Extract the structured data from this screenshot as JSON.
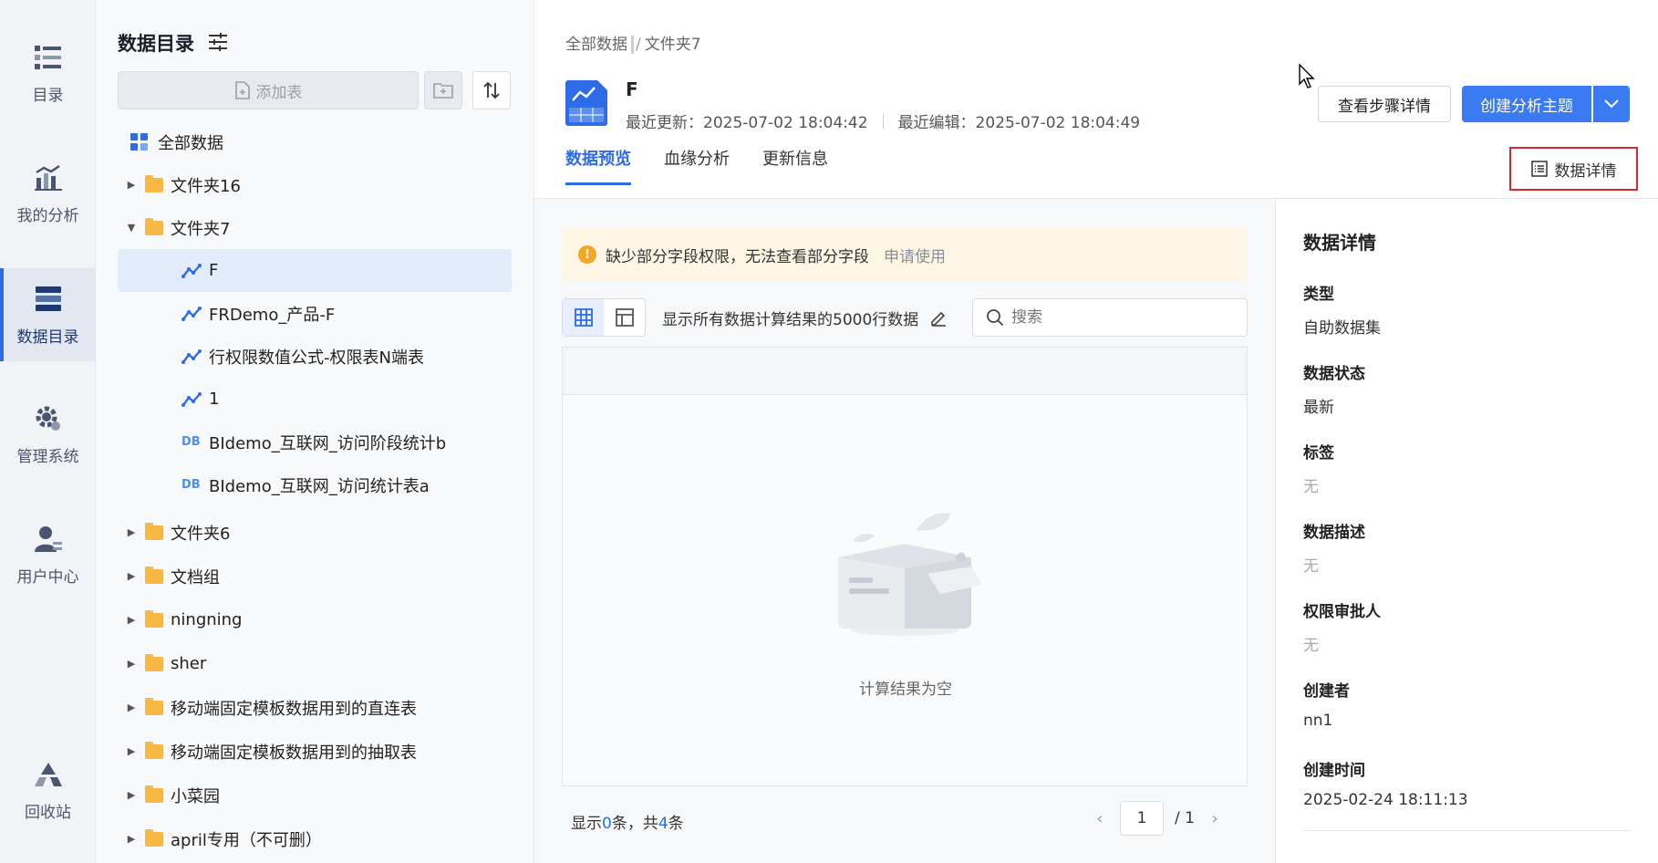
{
  "nav": {
    "items": [
      {
        "label": "目录",
        "icon": "list-icon"
      },
      {
        "label": "我的分析",
        "icon": "chart-icon"
      },
      {
        "label": "数据目录",
        "icon": "database-icon"
      },
      {
        "label": "管理系统",
        "icon": "gear-icon"
      },
      {
        "label": "用户中心",
        "icon": "user-icon"
      },
      {
        "label": "回收站",
        "icon": "recycle-icon"
      }
    ],
    "active": "数据目录"
  },
  "tree": {
    "title": "数据目录",
    "add_table": "添加表",
    "root": "全部数据",
    "rows": [
      {
        "label": "文件夹16",
        "type": "folder",
        "expanded": false
      },
      {
        "label": "文件夹7",
        "type": "folder",
        "expanded": true
      },
      {
        "label": "F",
        "type": "dataset",
        "selected": true
      },
      {
        "label": "FRDemo_产品-F",
        "type": "dataset"
      },
      {
        "label": "行权限数值公式-权限表N端表",
        "type": "dataset"
      },
      {
        "label": "1",
        "type": "dataset"
      },
      {
        "label": "BIdemo_互联网_访问阶段统计b",
        "type": "db"
      },
      {
        "label": "BIdemo_互联网_访问统计表a",
        "type": "db"
      },
      {
        "label": "文件夹6",
        "type": "folder",
        "expanded": false
      },
      {
        "label": "文档组",
        "type": "folder",
        "expanded": false
      },
      {
        "label": "ningning",
        "type": "folder",
        "expanded": false
      },
      {
        "label": "sher",
        "type": "folder",
        "expanded": false
      },
      {
        "label": "移动端固定模板数据用到的直连表",
        "type": "folder",
        "expanded": false
      },
      {
        "label": "移动端固定模板数据用到的抽取表",
        "type": "folder",
        "expanded": false
      },
      {
        "label": "小菜园",
        "type": "folder",
        "expanded": false
      },
      {
        "label": "april专用（不可删）",
        "type": "folder",
        "expanded": false
      }
    ],
    "db_badge": "DB"
  },
  "main": {
    "breadcrumb": {
      "root": "全部数据",
      "current": "文件夹7"
    },
    "title": "F",
    "last_update": "最近更新：2025-07-02 18:04:42",
    "last_edit": "最近编辑：2025-07-02 18:04:49",
    "step_btn": "查看步骤详情",
    "create_btn": "创建分析主题",
    "tabs": [
      "数据预览",
      "血缘分析",
      "更新信息"
    ],
    "active_tab": "数据预览",
    "detail_btn": "数据详情",
    "warning": "缺少部分字段权限，无法查看部分字段",
    "warning_link": "申请使用",
    "rows_text": "显示所有数据计算结果的5000行数据",
    "search_placeholder": "搜索",
    "empty_text": "计算结果为空",
    "footer": {
      "prefix": "显示",
      "shown": "0",
      "mid": "条，共",
      "total": "4",
      "suffix": "条"
    },
    "pager": {
      "page": "1",
      "of": "/ 1"
    }
  },
  "details": {
    "title": "数据详情",
    "fields": [
      {
        "key": "类型",
        "value": "自助数据集",
        "muted": false
      },
      {
        "key": "数据状态",
        "value": "最新",
        "muted": false
      },
      {
        "key": "标签",
        "value": "无",
        "muted": true
      },
      {
        "key": "数据描述",
        "value": "无",
        "muted": true
      },
      {
        "key": "权限审批人",
        "value": "无",
        "muted": true
      },
      {
        "key": "创建者",
        "value": "nn1",
        "muted": false
      },
      {
        "key": "创建时间",
        "value": "2025-02-24 18:11:13",
        "muted": false
      }
    ]
  },
  "colors": {
    "accent": "#3a7af2",
    "folder": "#f7b844",
    "highlight": "#d9272e"
  }
}
